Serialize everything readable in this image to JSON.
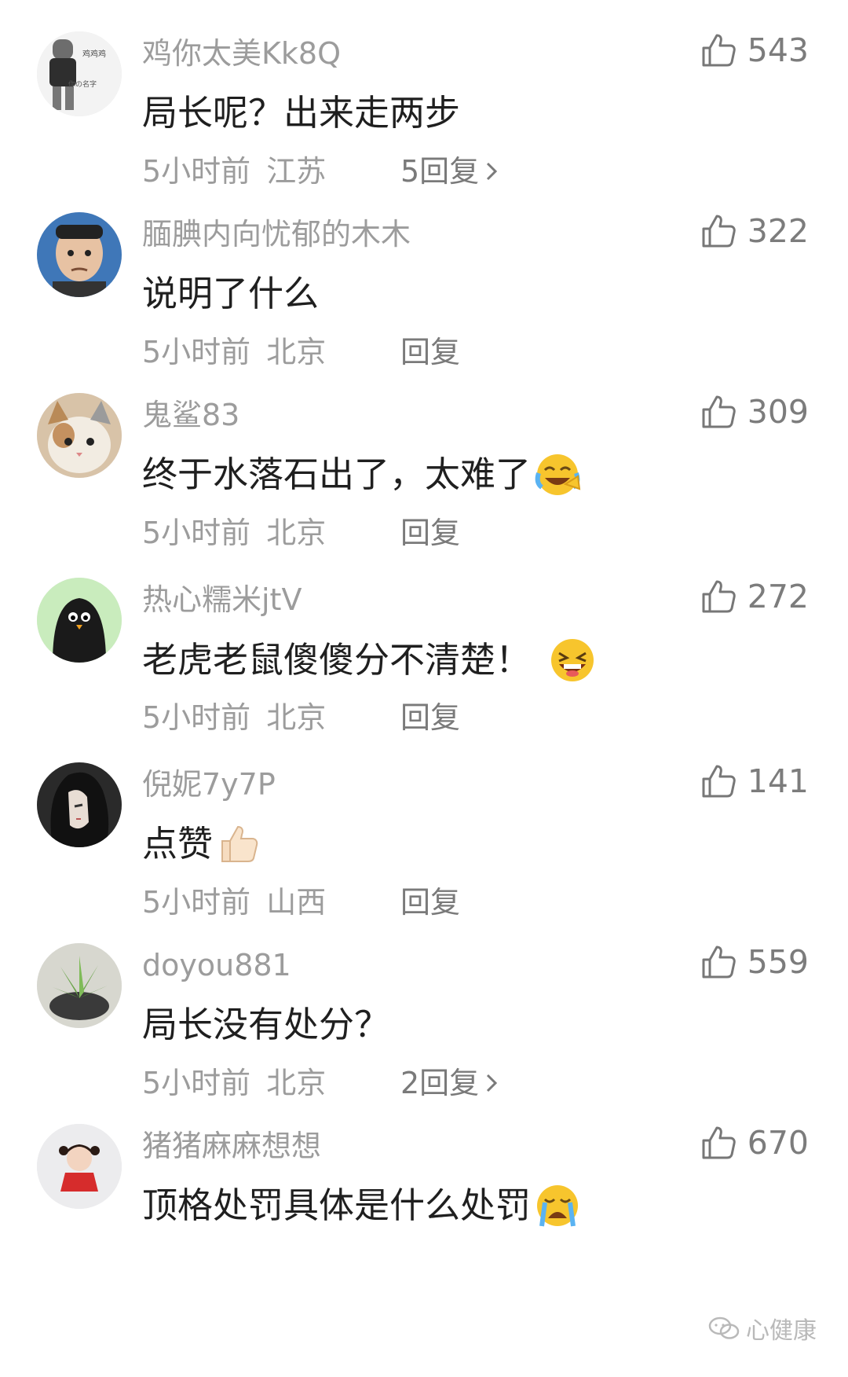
{
  "comments": [
    {
      "username": "鸡你太美Kk8Q",
      "text": "局长呢？出来走两步",
      "time": "5小时前",
      "location": "江苏",
      "reply": "5回复",
      "has_chevron": true,
      "likes": "543",
      "emoji": ""
    },
    {
      "username": "腼腆内向忧郁的木木",
      "text": "说明了什么",
      "time": "5小时前",
      "location": "北京",
      "reply": "回复",
      "has_chevron": false,
      "likes": "322",
      "emoji": ""
    },
    {
      "username": "鬼鲨83",
      "text": "终于水落石出了，太难了",
      "time": "5小时前",
      "location": "北京",
      "reply": "回复",
      "has_chevron": false,
      "likes": "309",
      "emoji": "crying-laughing-emoji"
    },
    {
      "username": "热心糯米jtV",
      "text": "老虎老鼠傻傻分不清楚！",
      "time": "5小时前",
      "location": "北京",
      "reply": "回复",
      "has_chevron": false,
      "likes": "272",
      "emoji": "laughing-emoji"
    },
    {
      "username": "倪妮7y7P",
      "text": "点赞",
      "time": "5小时前",
      "location": "山西",
      "reply": "回复",
      "has_chevron": false,
      "likes": "141",
      "emoji": "thumbs-up-emoji"
    },
    {
      "username": "doyou881",
      "text": "局长没有处分？",
      "time": "5小时前",
      "location": "北京",
      "reply": "2回复",
      "has_chevron": true,
      "likes": "559",
      "emoji": ""
    },
    {
      "username": "猪猪麻麻想想",
      "text": "顶格处罚具体是什么处罚",
      "time": "",
      "location": "",
      "reply": "",
      "has_chevron": false,
      "likes": "670",
      "emoji": "crying-emoji"
    }
  ],
  "watermark": {
    "text": "心健康",
    "icon": "wechat-icon"
  },
  "colors": {
    "username": "#9c9c9c",
    "text": "#1f1f1f",
    "meta": "#9c9c9c",
    "like": "#7c7c7c"
  }
}
